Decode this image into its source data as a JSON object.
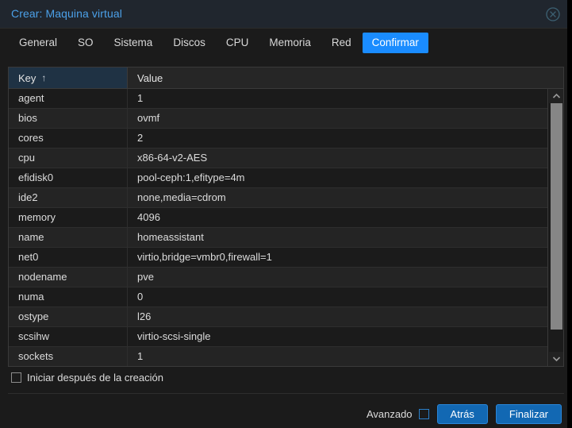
{
  "window": {
    "title": "Crear: Maquina virtual",
    "close_icon": "close-circle-icon"
  },
  "tabs": [
    {
      "label": "General",
      "active": false
    },
    {
      "label": "SO",
      "active": false
    },
    {
      "label": "Sistema",
      "active": false
    },
    {
      "label": "Discos",
      "active": false
    },
    {
      "label": "CPU",
      "active": false
    },
    {
      "label": "Memoria",
      "active": false
    },
    {
      "label": "Red",
      "active": false
    },
    {
      "label": "Confirmar",
      "active": true
    }
  ],
  "grid": {
    "columns": [
      {
        "label": "Key",
        "sorted": true,
        "sort_arrow": "↑"
      },
      {
        "label": "Value",
        "sorted": false,
        "sort_arrow": ""
      }
    ],
    "rows": [
      {
        "key": "agent",
        "value": "1"
      },
      {
        "key": "bios",
        "value": "ovmf"
      },
      {
        "key": "cores",
        "value": "2"
      },
      {
        "key": "cpu",
        "value": "x86-64-v2-AES"
      },
      {
        "key": "efidisk0",
        "value": "pool-ceph:1,efitype=4m"
      },
      {
        "key": "ide2",
        "value": "none,media=cdrom"
      },
      {
        "key": "memory",
        "value": "4096"
      },
      {
        "key": "name",
        "value": "homeassistant"
      },
      {
        "key": "net0",
        "value": "virtio,bridge=vmbr0,firewall=1"
      },
      {
        "key": "nodename",
        "value": "pve"
      },
      {
        "key": "numa",
        "value": "0"
      },
      {
        "key": "ostype",
        "value": "l26"
      },
      {
        "key": "scsihw",
        "value": "virtio-scsi-single"
      },
      {
        "key": "sockets",
        "value": "1"
      }
    ],
    "scrollbar": {
      "up_icon": "chevron-up-icon",
      "down_icon": "chevron-down-icon"
    }
  },
  "startup": {
    "label": "Iniciar después de la creación",
    "checked": false
  },
  "footer": {
    "advanced_label": "Avanzado",
    "advanced_checked": false,
    "back_label": "Atrás",
    "finish_label": "Finalizar"
  },
  "colors": {
    "accent": "#1a8cff",
    "title_text": "#4ba0e8",
    "button": "#1268b3",
    "header_key_bg": "#1f3244",
    "scroll_thumb": "#868686"
  }
}
